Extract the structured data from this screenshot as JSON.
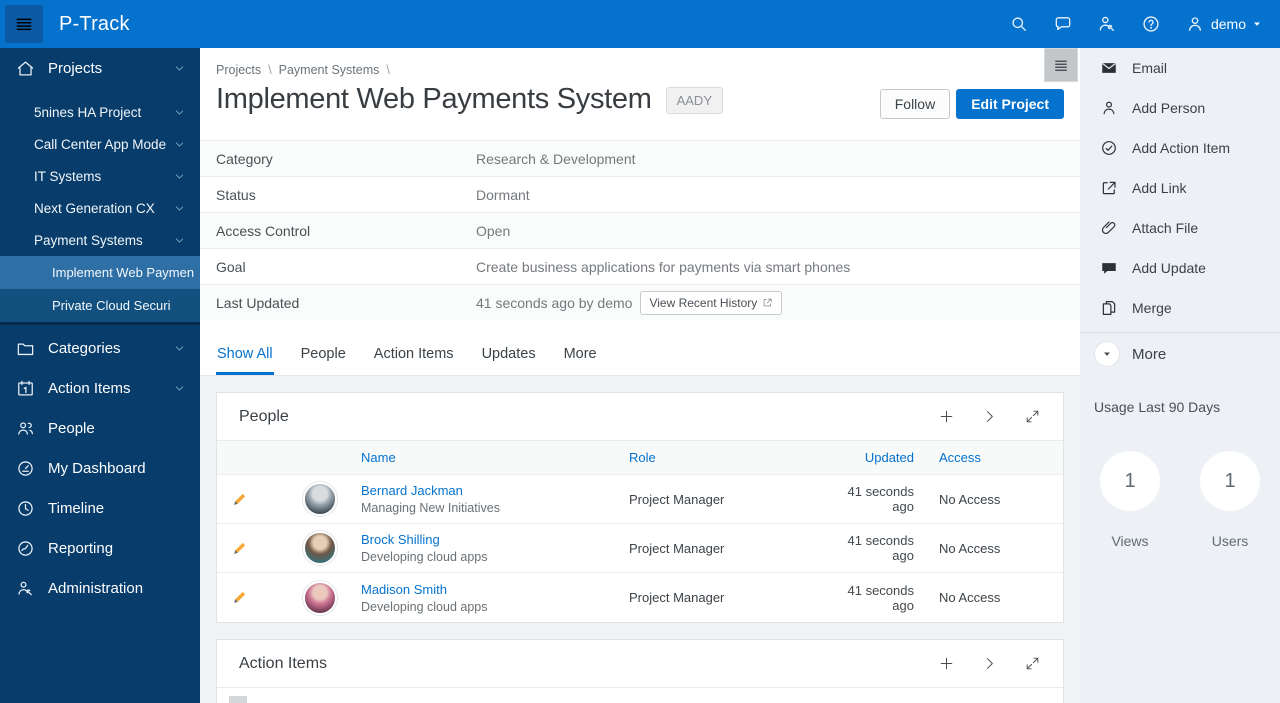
{
  "topbar": {
    "brand": "P-Track",
    "user": "demo"
  },
  "sidebar": {
    "projects_label": "Projects",
    "project_items": [
      {
        "label": "5nines HA Project"
      },
      {
        "label": "Call Center App Mode"
      },
      {
        "label": "IT Systems"
      },
      {
        "label": "Next Generation CX"
      },
      {
        "label": "Payment Systems"
      }
    ],
    "sub_projects": [
      {
        "label": "Implement Web Paymen",
        "selected": true
      },
      {
        "label": "Private Cloud Securi",
        "selected": false
      }
    ],
    "items": [
      {
        "label": "Categories"
      },
      {
        "label": "Action Items"
      },
      {
        "label": "People"
      },
      {
        "label": "My Dashboard"
      },
      {
        "label": "Timeline"
      },
      {
        "label": "Reporting"
      },
      {
        "label": "Administration"
      }
    ]
  },
  "main": {
    "breadcrumb": {
      "crumb1": "Projects",
      "crumb2": "Payment Systems",
      "sep": "\\"
    },
    "title": "Implement Web Payments System",
    "badge": "AADY",
    "follow_label": "Follow",
    "edit_label": "Edit Project",
    "details": [
      {
        "label": "Category",
        "value": "Research & Development"
      },
      {
        "label": "Status",
        "value": "Dormant"
      },
      {
        "label": "Access Control",
        "value": "Open"
      },
      {
        "label": "Goal",
        "value": "Create business applications for payments via smart phones"
      },
      {
        "label": "Last Updated",
        "value": "41 seconds ago by demo",
        "button": "View Recent History"
      }
    ],
    "tabs": [
      {
        "label": "Show All"
      },
      {
        "label": "People"
      },
      {
        "label": "Action Items"
      },
      {
        "label": "Updates"
      },
      {
        "label": "More"
      }
    ],
    "people_panel": {
      "title": "People",
      "columns": {
        "name": "Name",
        "role": "Role",
        "updated": "Updated",
        "access": "Access"
      },
      "rows": [
        {
          "name": "Bernard Jackman",
          "subtitle": "Managing New Initiatives",
          "role": "Project Manager",
          "updated": "41 seconds ago",
          "access": "No Access"
        },
        {
          "name": "Brock Shilling",
          "subtitle": "Developing cloud apps",
          "role": "Project Manager",
          "updated": "41 seconds ago",
          "access": "No Access"
        },
        {
          "name": "Madison Smith",
          "subtitle": "Developing cloud apps",
          "role": "Project Manager",
          "updated": "41 seconds ago",
          "access": "No Access"
        }
      ]
    },
    "action_items_panel": {
      "title": "Action Items"
    }
  },
  "rightbar": {
    "actions": [
      {
        "label": "Email",
        "icon": "envelope-icon"
      },
      {
        "label": "Add Person",
        "icon": "person-icon"
      },
      {
        "label": "Add Action Item",
        "icon": "check-circle-icon"
      },
      {
        "label": "Add Link",
        "icon": "external-link-icon"
      },
      {
        "label": "Attach File",
        "icon": "paperclip-icon"
      },
      {
        "label": "Add Update",
        "icon": "speech-bubble-icon"
      },
      {
        "label": "Merge",
        "icon": "merge-icon"
      }
    ],
    "more_label": "More",
    "usage": {
      "title": "Usage Last 90 Days",
      "stats": [
        {
          "value": "1",
          "label": "Views"
        },
        {
          "value": "1",
          "label": "Users"
        }
      ]
    }
  },
  "colors": {
    "accent": "#0572CE",
    "topbar": "#0572CE",
    "sidebar": "#073C6B",
    "sidebar_selected": "#2E6FA6",
    "link": "#0572CE",
    "pencil": "#F7A938"
  }
}
